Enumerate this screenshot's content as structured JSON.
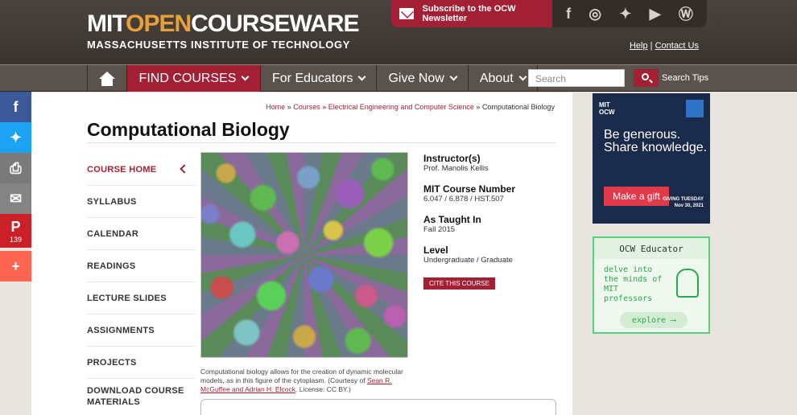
{
  "header": {
    "logo_part1": "MIT",
    "logo_part2": "OPEN",
    "logo_part3": "COURSEWARE",
    "logo_subtitle": "MASSACHUSETTS INSTITUTE OF TECHNOLOGY",
    "newsletter_label": "Subscribe to the OCW Newsletter",
    "social_icons": [
      "facebook-icon",
      "instagram-icon",
      "twitter-icon",
      "youtube-icon",
      "wordpress-icon"
    ],
    "help_link": "Help",
    "separator": "|",
    "contact_link": "Contact Us"
  },
  "nav": {
    "items": [
      {
        "label": "FIND COURSES",
        "active": true
      },
      {
        "label": "For Educators"
      },
      {
        "label": "Give Now"
      },
      {
        "label": "About"
      }
    ],
    "search_placeholder": "Search",
    "search_tips": "Search Tips"
  },
  "share_bar": {
    "pinterest_count": "139",
    "colors": {
      "facebook": "#3b5998",
      "twitter": "#1da1f2",
      "print": "#7a7a7a",
      "email": "#848484",
      "pinterest": "#cb2027",
      "more": "#ff6550"
    }
  },
  "breadcrumb": {
    "items": [
      "Home",
      "Courses",
      "Electrical Engineering and Computer Science"
    ],
    "current": "Computational Biology",
    "separator": "»"
  },
  "page_title": "Computational Biology",
  "course_nav": [
    "COURSE HOME",
    "SYLLABUS",
    "CALENDAR",
    "READINGS",
    "LECTURE SLIDES",
    "ASSIGNMENTS",
    "PROJECTS",
    "DOWNLOAD COURSE MATERIALS"
  ],
  "caption": {
    "text": "Computational biology allows for the creation of dynamic molecular models, as in this figure of the cytoplasm. (Courtesy of",
    "link": "Sean R. McGuffee and Adrian H. Elcock",
    "license": ". License: CC BY.)"
  },
  "course_info": {
    "instructor_label": "Instructor(s)",
    "instructor": "Prof. Manolis Kellis",
    "number_label": "MIT Course Number",
    "number": "6.047 / 6.878 / HST.507",
    "taught_label": "As Taught In",
    "taught": "Fall 2015",
    "level_label": "Level",
    "level": "Undergraduate / Graduate",
    "cite_button": "CITE THIS COURSE"
  },
  "ad_giving": {
    "brand": "MIT\nOCW",
    "slogan": "Be generous. Share knowledge.",
    "button": "Make a gift",
    "tag": "GIVING TUESDAY",
    "date": "Nov 30, 2021"
  },
  "ad_educator": {
    "title": "OCW Educator",
    "body": "delve into the minds of MIT professors",
    "button": "explore"
  },
  "accent_color": "#a31f34"
}
